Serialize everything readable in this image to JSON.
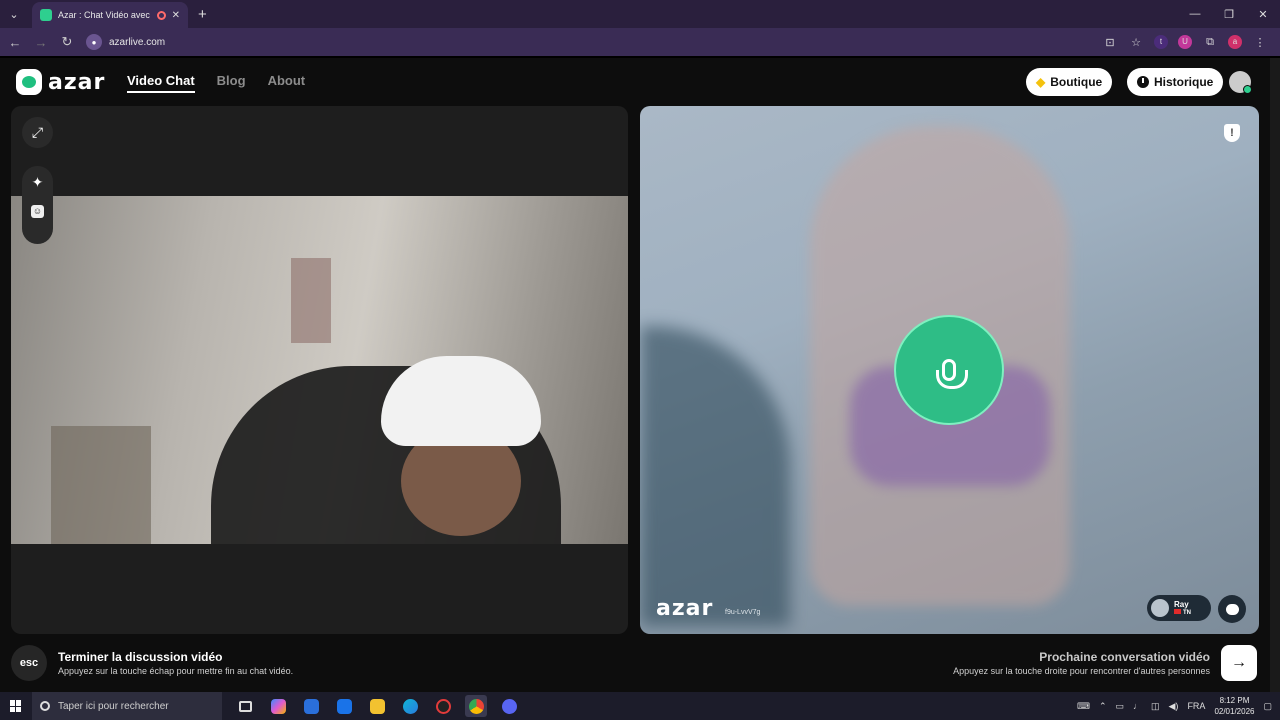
{
  "browser": {
    "tab_title": "Azar : Chat Vidéo avec de n",
    "new_tab_symbol": "+",
    "url": "azarlive.com",
    "extension_t": "t",
    "extension_u": "U",
    "profile_letter": "a"
  },
  "site": {
    "logo_text": "azar",
    "nav": [
      "Video Chat",
      "Blog",
      "About"
    ],
    "active_nav": "Video Chat",
    "boutique_label": "Boutique",
    "historique_label": "Historique",
    "accent_color": "#2ebd86"
  },
  "remote": {
    "watermark": "azar",
    "watermark_id": "f9u-LvvV7g",
    "peer_name": "Ray",
    "peer_country": "TN",
    "shield_symbol": "!"
  },
  "bottom": {
    "esc_label": "esc",
    "end_title": "Terminer la discussion vidéo",
    "end_subtitle": "Appuyez sur la touche échap pour mettre fin au chat vidéo.",
    "next_title": "Prochaine conversation vidéo",
    "next_subtitle": "Appuyez sur la touche droite pour rencontrer d'autres personnes",
    "next_symbol": "→"
  },
  "taskbar": {
    "search_placeholder": "Taper ici pour rechercher",
    "language": "FRA",
    "time": "8:12 PM",
    "date": "02/01/2026"
  }
}
